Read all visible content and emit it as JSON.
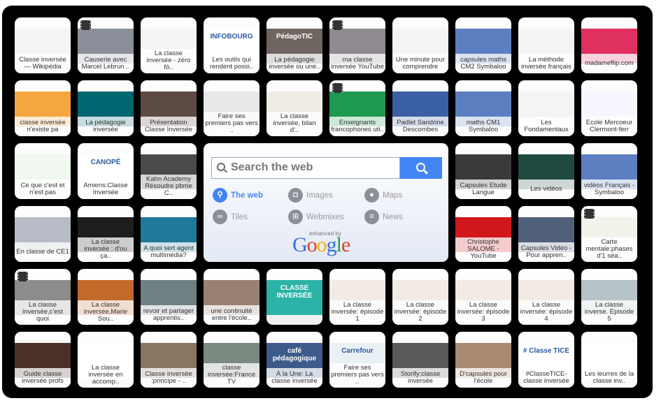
{
  "search": {
    "placeholder": "Search the web",
    "options": [
      {
        "label": "The web",
        "icon": "search-icon",
        "active": true
      },
      {
        "label": "Images",
        "icon": "camera-icon",
        "active": false
      },
      {
        "label": "Maps",
        "icon": "map-pin-icon",
        "active": false
      },
      {
        "label": "Tiles",
        "icon": "link-icon",
        "active": false
      },
      {
        "label": "Webmixes",
        "icon": "grid-globe-icon",
        "active": false
      },
      {
        "label": "News",
        "icon": "menu-icon",
        "active": false
      }
    ],
    "enhanced_by": "enhanced by",
    "brand": "Google",
    "accent": "#4285f4"
  },
  "tiles": [
    {
      "label": "Classe inversée — Wikipédia",
      "bg": "#f4f4f4"
    },
    {
      "label": "Causerie avec Marcel Lebrun ..",
      "bg": "#8a8f9a",
      "video": true
    },
    {
      "label": "La classe inversée - zéro fô..",
      "bg": "#f4f4f4"
    },
    {
      "label": "Les outils qui rendent possi..",
      "bg": "#ffffff",
      "logo": "INFOBOURG"
    },
    {
      "label": "La pédagogie inversée ou une..",
      "bg": "#6f6560",
      "logo": "PédagoTIC"
    },
    {
      "label": "ma classe inversée  YouTube",
      "bg": "#8e8a8f",
      "video": true
    },
    {
      "label": "Une minute pour comprendre",
      "bg": "#f4f4f4"
    },
    {
      "label": "capsules maths CM2 Symbaloo",
      "bg": "#5b7fc0"
    },
    {
      "label": "La méthode inversée français",
      "bg": "#f4f4f4"
    },
    {
      "label": "madameflip.com",
      "bg": "#e0305f"
    },
    {
      "label": "classe inversée n'existe pa",
      "bg": "#f5a640"
    },
    {
      "label": "La pédagogie inversée",
      "bg": "#006670"
    },
    {
      "label": "Présentation Classe Inversée",
      "bg": "#5d4a44"
    },
    {
      "label": "Faire ses premiers pas vers ..",
      "bg": "#e8e8e8"
    },
    {
      "label": "La classe inversée, bilan d'..",
      "bg": "#f0ede6"
    },
    {
      "label": "Enseignants francophones uti..",
      "bg": "#1e9a50",
      "video": true
    },
    {
      "label": "Padlet Sandrine Descombes",
      "bg": "#3b5fa5"
    },
    {
      "label": "maths CM1 Symbaloo",
      "bg": "#5b7fc0"
    },
    {
      "label": "Les Fondamentaux",
      "bg": "#f4f4f4"
    },
    {
      "label": "Ecole Mercoeur Clermont-ferr",
      "bg": "#f7f7ff"
    },
    {
      "label": "Ce que c'est et n'est pas",
      "bg": "#f0f8f0"
    },
    {
      "label": "Amiens:Classe Inversée",
      "bg": "#ffffff",
      "logo": "CANOPÉ"
    },
    {
      "label": "Kahn Academy Résoudre pbme C..",
      "bg": "#4a4a4a"
    },
    {
      "label": "Capsules Etude Langue",
      "bg": "#3a3a3a"
    },
    {
      "label": "Les vidéos",
      "bg": "#1f4a40"
    },
    {
      "label": "vidéos Français - Symbaloo",
      "bg": "#5b7fc0"
    },
    {
      "label": "En classe de CE1",
      "bg": "#b8bcc6"
    },
    {
      "label": "La classe inversée : d'ou ça..",
      "bg": "#1e1e1e"
    },
    {
      "label": "A quoi sert agent multimédia?",
      "bg": "#1f7a9a"
    },
    {
      "label": "Christophe SALOME - YouTube",
      "bg": "#d0171b"
    },
    {
      "label": "Capsules Vidéo - Pour appren..",
      "bg": "#50607a"
    },
    {
      "label": "Carte mentale:phases d'1 séa..",
      "bg": "#f2f2ea",
      "video": true
    },
    {
      "label": "La classe inversée,c'est quoi",
      "bg": "#8c8c8c",
      "video": true
    },
    {
      "label": "La classe inversée,Marie Sou..",
      "bg": "#c26a2a"
    },
    {
      "label": "revoir et partager apprentis..",
      "bg": "#6f7f84"
    },
    {
      "label": "une continuité entre l'école..",
      "bg": "#9a8070"
    },
    {
      "label": "",
      "bg": "#2ab3a6",
      "logo": "CLASSE INVERSÉE"
    },
    {
      "label": "La classe inversée: épisode 1",
      "bg": "#f2ebe4"
    },
    {
      "label": "La classe inversée: épisode 2",
      "bg": "#f2ebe4"
    },
    {
      "label": "La classe inversée: épisode 3",
      "bg": "#f2ebe4"
    },
    {
      "label": "La classe inversée: épisode 4",
      "bg": "#f2ebe4"
    },
    {
      "label": "La classe inverse. Episode 5",
      "bg": "#b6c3c8"
    },
    {
      "label": "Guide classe inversée profs",
      "bg": "#4a3028"
    },
    {
      "label": "La classe inversée en accomp..",
      "bg": "#ffffff"
    },
    {
      "label": "Classe inversée :principe - ..",
      "bg": "#8a7462"
    },
    {
      "label": "classe inversée:France TV",
      "bg": "#7a8a80"
    },
    {
      "label": "À la Une: La classe inversée",
      "bg": "#3d5b8a",
      "logo": "café pédagogique"
    },
    {
      "label": "Faire ses premiers pas vers ..",
      "bg": "#eaf1f5",
      "logo": "Carrefour"
    },
    {
      "label": "Storify:classe inversée",
      "bg": "#5a5a5a"
    },
    {
      "label": "D'capsules pour l'école",
      "bg": "#a88a70"
    },
    {
      "label": "#ClasseTICE-classe inversée",
      "bg": "#ffffff",
      "logo": "# Classe TICE"
    },
    {
      "label": "Les leurres de la classe inv..",
      "bg": "#ffffff"
    }
  ]
}
